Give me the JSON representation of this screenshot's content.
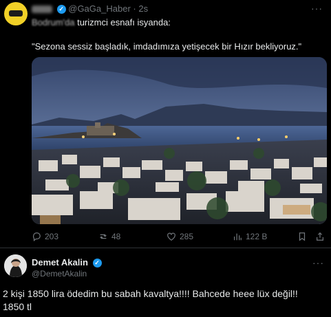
{
  "post1": {
    "handle": "@GaGa_Haber",
    "time": "2s",
    "separator": "·",
    "more": "···",
    "headline_blurred": "Bodrum'da",
    "headline_rest": " turizmci esnafı isyanda:",
    "quote": "\"Sezona sessiz başladık, imdadımıza yetişecek bir Hızır bekliyoruz.\"",
    "actions": {
      "replies": "203",
      "retweets": "48",
      "likes": "285",
      "views": "122 B"
    }
  },
  "post2": {
    "name": "Demet Akalin",
    "handle": "@DemetAkalin",
    "more": "···",
    "body_line1": "2 kişi 1850 lira ödedim bu sabah kavaltya!!!! Bahcede heee lüx değil!!",
    "body_line2": "1850 tl"
  },
  "colors": {
    "background": "#000000",
    "text": "#e7e9ea",
    "muted": "#71767b",
    "verified": "#1d9bf0",
    "avatar1": "#f1d027"
  }
}
